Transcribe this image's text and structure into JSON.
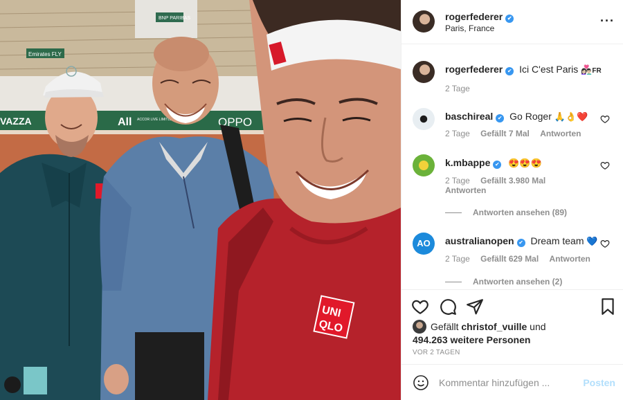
{
  "post": {
    "username": "rogerfederer",
    "location": "Paris, France",
    "more_icon": "more-icon",
    "caption": "Ici C'est Paris",
    "caption_emoji": "👩🏻‍❤️‍👨🏻",
    "caption_flag": "FR",
    "caption_age": "2 Tage"
  },
  "photo": {
    "banners": [
      "Emirates FLY",
      "VAZZA",
      "All",
      "OPPO",
      "ACCOR LIVE LIMITLESS",
      "BNP PARIBAS"
    ],
    "shirt_logo_top": "UNI",
    "shirt_logo_bottom": "QLO"
  },
  "comments": [
    {
      "username": "baschireal",
      "verified": true,
      "text": "Go Roger",
      "emoji": "🙏👌❤️",
      "age": "2 Tage",
      "likes": "Gefällt 7 Mal",
      "reply": "Antworten"
    },
    {
      "username": "k.mbappe",
      "verified": true,
      "text": "",
      "emoji": "😍😍😍",
      "age": "2 Tage",
      "likes": "Gefällt 3.980 Mal",
      "reply": "Antworten",
      "view_replies": "Antworten ansehen (89)"
    },
    {
      "username": "australianopen",
      "verified": true,
      "text": "Dream team",
      "emoji": "💙",
      "age": "2 Tage",
      "likes": "Gefällt 629 Mal",
      "reply": "Antworten",
      "view_replies": "Antworten ansehen (2)"
    }
  ],
  "likes_line": {
    "prefix": "Gefällt",
    "liker": "christof_vuille",
    "middle": "und",
    "count": "494.263 weitere Personen"
  },
  "timestamp": "VOR 2 TAGEN",
  "comment_box": {
    "placeholder": "Kommentar hinzufügen ...",
    "post_label": "Posten"
  },
  "colors": {
    "verified": "#3897f0",
    "post_button": "#b2dffc",
    "uniqlo_red": "#e1192a"
  }
}
